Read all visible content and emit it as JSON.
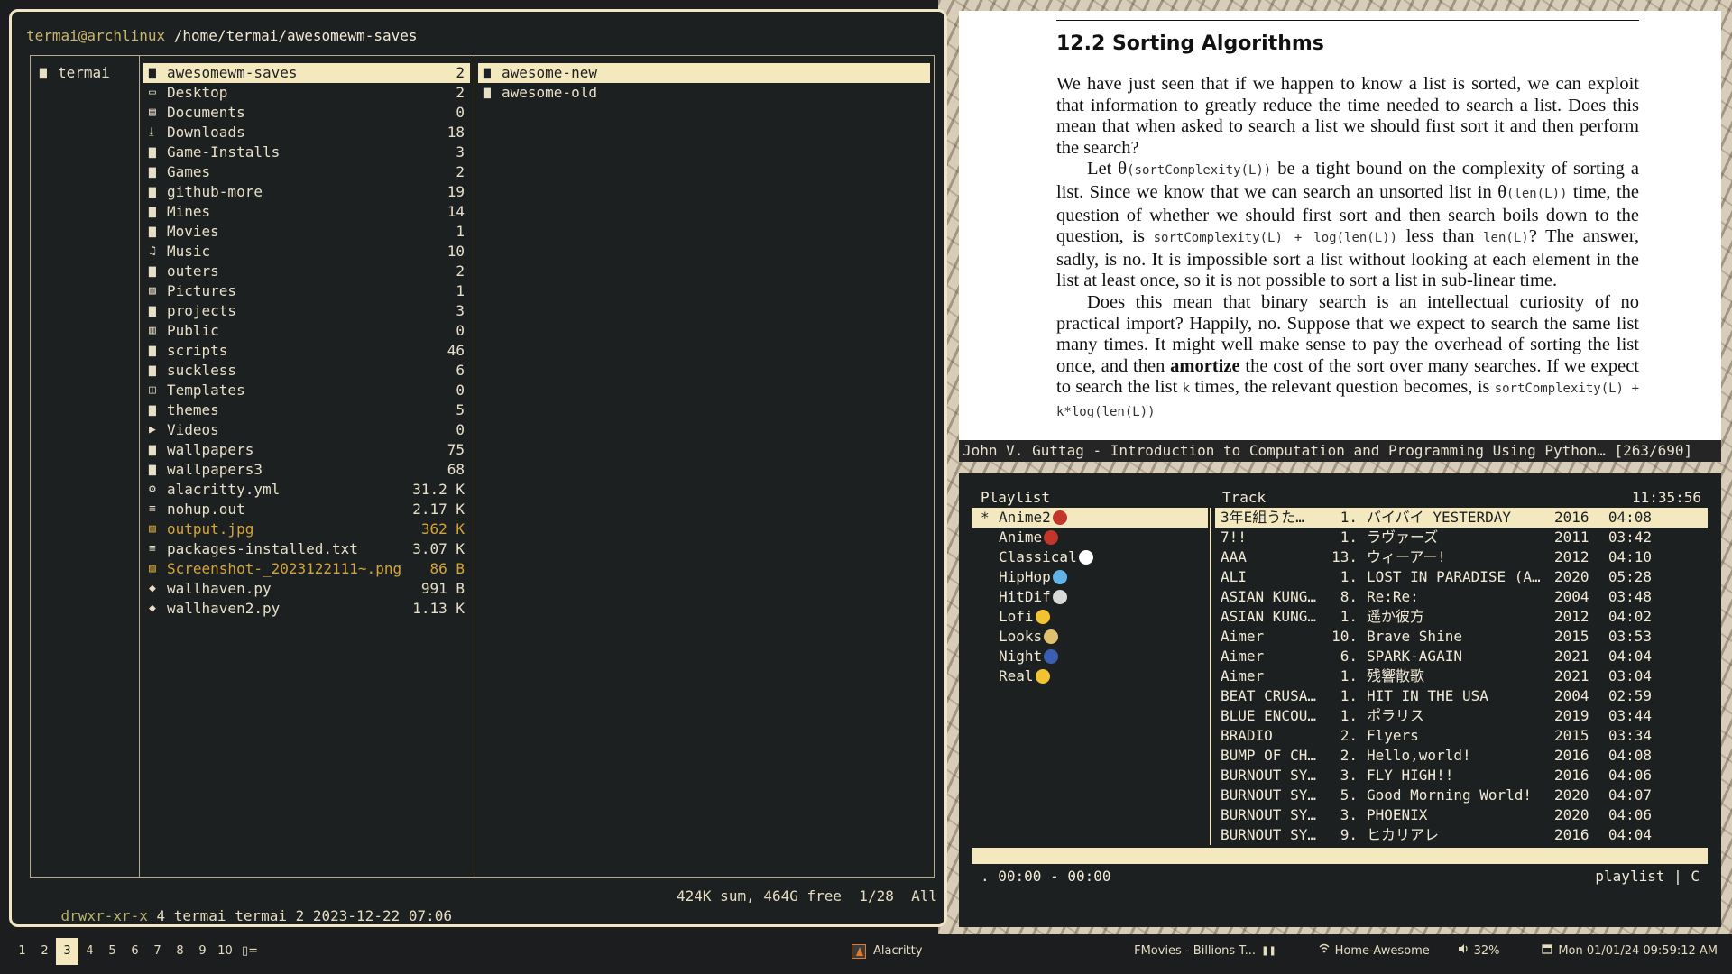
{
  "ranger": {
    "user_host": "termai@archlinux",
    "cwd": "/home/termai/awesomewm-saves",
    "parent": [
      {
        "name": "termai",
        "icon": "folder"
      }
    ],
    "current": [
      {
        "name": "awesomewm-saves",
        "size": "2",
        "icon": "folder",
        "selected": true
      },
      {
        "name": "Desktop",
        "size": "2",
        "icon": "desktop"
      },
      {
        "name": "Documents",
        "size": "0",
        "icon": "documents"
      },
      {
        "name": "Downloads",
        "size": "18",
        "icon": "download"
      },
      {
        "name": "Game-Installs",
        "size": "3",
        "icon": "folder"
      },
      {
        "name": "Games",
        "size": "2",
        "icon": "folder"
      },
      {
        "name": "github-more",
        "size": "19",
        "icon": "folder"
      },
      {
        "name": "Mines",
        "size": "14",
        "icon": "folder"
      },
      {
        "name": "Movies",
        "size": "1",
        "icon": "folder"
      },
      {
        "name": "Music",
        "size": "10",
        "icon": "headphones"
      },
      {
        "name": "outers",
        "size": "2",
        "icon": "folder"
      },
      {
        "name": "Pictures",
        "size": "1",
        "icon": "image"
      },
      {
        "name": "projects",
        "size": "3",
        "icon": "folder"
      },
      {
        "name": "Public",
        "size": "0",
        "icon": "building"
      },
      {
        "name": "scripts",
        "size": "46",
        "icon": "folder"
      },
      {
        "name": "suckless",
        "size": "6",
        "icon": "folder"
      },
      {
        "name": "Templates",
        "size": "0",
        "icon": "template"
      },
      {
        "name": "themes",
        "size": "5",
        "icon": "folder"
      },
      {
        "name": "Videos",
        "size": "0",
        "icon": "video"
      },
      {
        "name": "wallpapers",
        "size": "75",
        "icon": "folder"
      },
      {
        "name": "wallpapers3",
        "size": "68",
        "icon": "folder"
      },
      {
        "name": "alacritty.yml",
        "size": "31.2 K",
        "icon": "gear"
      },
      {
        "name": "nohup.out",
        "size": "2.17 K",
        "icon": "text"
      },
      {
        "name": "output.jpg",
        "size": "362 K",
        "icon": "image",
        "highlight": true
      },
      {
        "name": "packages-installed.txt",
        "size": "3.07 K",
        "icon": "text"
      },
      {
        "name": "Screenshot-_2023122111~.png",
        "size": "86 B",
        "icon": "image",
        "highlight": true
      },
      {
        "name": "wallhaven.py",
        "size": "991 B",
        "icon": "python"
      },
      {
        "name": "wallhaven2.py",
        "size": "1.13 K",
        "icon": "python"
      }
    ],
    "preview": [
      {
        "name": "awesome-new",
        "icon": "folder",
        "selected": true
      },
      {
        "name": "awesome-old",
        "icon": "folder"
      }
    ],
    "status_left_perm": "drwxr-xr-x",
    "status_left_rest": " 4 termai termai 2 2023-12-22 07:06",
    "status_right": "424K sum, 464G free  1/28  All"
  },
  "pdf": {
    "section": "12.2   Sorting Algorithms",
    "p1": "We have just seen that if we happen to know a list is sorted, we can exploit that information to greatly reduce the time needed to search a list. Does this mean that when asked to search a list we should first sort it and then perform the search?",
    "p2_a": "Let θ",
    "p2_code1": "(sortComplexity(L))",
    "p2_b": " be a tight bound on the complexity of sorting a list. Since we know that we can search an unsorted list in θ",
    "p2_code2": "(len(L))",
    "p2_c": " time, the question of whether we should first sort and then search boils down to the question, is ",
    "p2_code3": "sortComplexity(L) + log(len(L))",
    "p2_d": " less than ",
    "p2_code4": "len(L)",
    "p2_e": "? The answer, sadly, is no. It is impossible sort a list without looking at each element in the list at least once, so it is not possible to sort a list in sub-linear time.",
    "p3_a": "Does this mean that binary search is an intellectual curiosity of no practical import? Happily, no. Suppose that we expect to search the same list many times. It might well make sense to pay the overhead of sorting the list once, and then ",
    "p3_bold": "amortize",
    "p3_b": " the cost of the sort over many searches. If we expect to search the list ",
    "p3_code1": "k",
    "p3_c": " times, the relevant question becomes, is ",
    "p3_code2": "sortComplexity(L) + k*log(len(L))",
    "statusbar": "John V. Guttag - Introduction to Computation and Programming Using Python… [263/690]"
  },
  "mpd": {
    "playlist_header": "Playlist",
    "track_header": "Track",
    "clock": "11:35:56",
    "playlists": [
      {
        "name": "Anime2",
        "emoji_color": "#c2362b",
        "selected": true
      },
      {
        "name": "Anime",
        "emoji_color": "#c2362b"
      },
      {
        "name": "Classical",
        "emoji_color": "#ffffff"
      },
      {
        "name": "HipHop",
        "emoji_color": "#5fb3e6"
      },
      {
        "name": "HitDif",
        "emoji_color": "#d8d8d8"
      },
      {
        "name": "Lofi",
        "emoji_color": "#f2c230"
      },
      {
        "name": "Looks",
        "emoji_color": "#e0c070"
      },
      {
        "name": "Night",
        "emoji_color": "#3b5fb0"
      },
      {
        "name": "Real",
        "emoji_color": "#f2c230"
      }
    ],
    "tracks": [
      {
        "artist": "3年E組うた…",
        "no": "1.",
        "title": "バイバイ YESTERDAY",
        "year": "2016",
        "dur": "04:08",
        "selected": true
      },
      {
        "artist": "7!!",
        "no": "1.",
        "title": "ラヴァーズ",
        "year": "2011",
        "dur": "03:42"
      },
      {
        "artist": "AAA",
        "no": "13.",
        "title": "ウィーアー!",
        "year": "2012",
        "dur": "04:10"
      },
      {
        "artist": "ALI",
        "no": "1.",
        "title": "LOST IN PARADISE (A…",
        "year": "2020",
        "dur": "05:28"
      },
      {
        "artist": "ASIAN KUNG…",
        "no": "8.",
        "title": "Re:Re:",
        "year": "2004",
        "dur": "03:48"
      },
      {
        "artist": "ASIAN KUNG…",
        "no": "1.",
        "title": "遥か彼方",
        "year": "2012",
        "dur": "04:02"
      },
      {
        "artist": "Aimer",
        "no": "10.",
        "title": "Brave Shine",
        "year": "2015",
        "dur": "03:53"
      },
      {
        "artist": "Aimer",
        "no": "6.",
        "title": "SPARK-AGAIN",
        "year": "2021",
        "dur": "04:04"
      },
      {
        "artist": "Aimer",
        "no": "1.",
        "title": "残響散歌",
        "year": "2021",
        "dur": "03:04"
      },
      {
        "artist": "BEAT CRUSA…",
        "no": "1.",
        "title": "HIT IN THE USA",
        "year": "2004",
        "dur": "02:59"
      },
      {
        "artist": "BLUE ENCOU…",
        "no": "1.",
        "title": "ポラリス",
        "year": "2019",
        "dur": "03:44"
      },
      {
        "artist": "BRADIO",
        "no": "2.",
        "title": "Flyers",
        "year": "2015",
        "dur": "03:34"
      },
      {
        "artist": "BUMP OF CH…",
        "no": "2.",
        "title": "Hello,world!",
        "year": "2016",
        "dur": "04:08"
      },
      {
        "artist": "BURNOUT SY…",
        "no": "3.",
        "title": "FLY HIGH!!",
        "year": "2016",
        "dur": "04:06"
      },
      {
        "artist": "BURNOUT SY…",
        "no": "5.",
        "title": "Good Morning World!",
        "year": "2020",
        "dur": "04:07"
      },
      {
        "artist": "BURNOUT SY…",
        "no": "3.",
        "title": "PHOENIX",
        "year": "2020",
        "dur": "04:06"
      },
      {
        "artist": "BURNOUT SY…",
        "no": "9.",
        "title": "ヒカリアレ",
        "year": "2016",
        "dur": "04:04"
      }
    ],
    "time": ". 00:00 - 00:00",
    "mode": "playlist | C"
  },
  "wibar": {
    "tags": [
      "1",
      "2",
      "3",
      "4",
      "5",
      "6",
      "7",
      "8",
      "9",
      "10"
    ],
    "active_tag": "3",
    "layout_symbol": "▯=",
    "task": "Alacritty",
    "music": "FMovies - Billions T...",
    "pause": "❚❚",
    "wifi": "Home-Awesome",
    "volume": "32%",
    "datetime": "Mon 01/01/24 09:59:12 AM"
  }
}
